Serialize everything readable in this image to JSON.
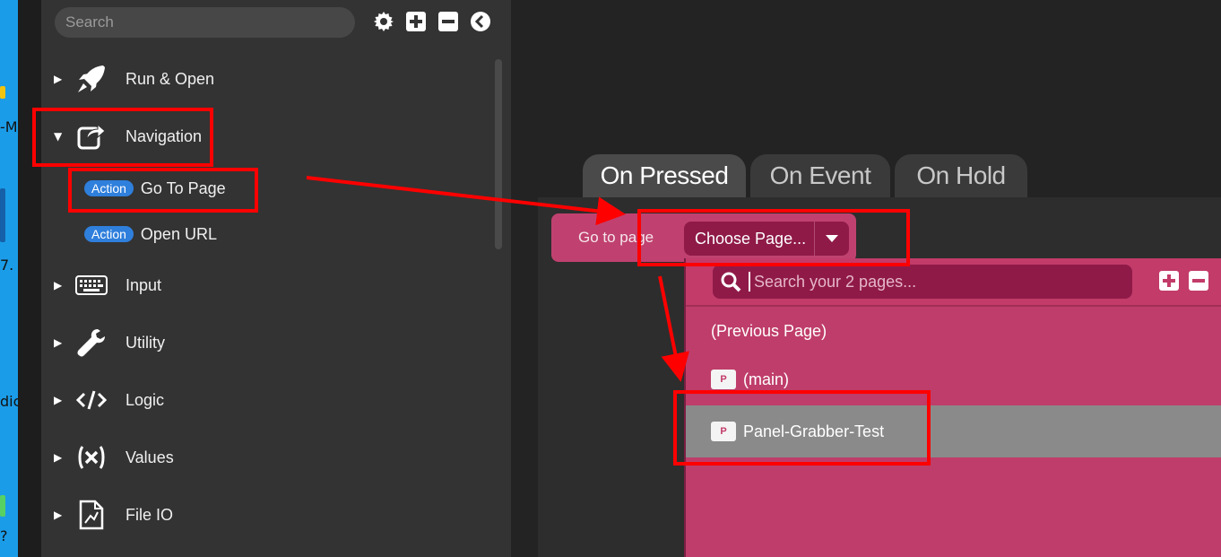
{
  "desktop": {
    "fragments": [
      "-M",
      "7.",
      "dic",
      "?"
    ]
  },
  "sidebar": {
    "search_placeholder": "Search",
    "toolbar_icons": [
      "gear-icon",
      "expand-all-icon",
      "collapse-all-icon",
      "back-icon"
    ],
    "categories": [
      {
        "label": "Run & Open",
        "icon": "rocket-icon",
        "expanded": false
      },
      {
        "label": "Navigation",
        "icon": "share-icon",
        "expanded": true
      },
      {
        "label": "Input",
        "icon": "keyboard-icon",
        "expanded": false
      },
      {
        "label": "Utility",
        "icon": "wrench-icon",
        "expanded": false
      },
      {
        "label": "Logic",
        "icon": "code-icon",
        "expanded": false
      },
      {
        "label": "Values",
        "icon": "variable-icon",
        "expanded": false
      },
      {
        "label": "File IO",
        "icon": "file-icon",
        "expanded": false
      }
    ],
    "navigation_actions": [
      {
        "badge": "Action",
        "label": "Go To Page"
      },
      {
        "badge": "Action",
        "label": "Open URL"
      }
    ]
  },
  "tabs": [
    {
      "label": "On Pressed",
      "active": true
    },
    {
      "label": "On Event",
      "active": false
    },
    {
      "label": "On Hold",
      "active": false
    }
  ],
  "action_block": {
    "label": "Go to page",
    "dropdown_value": "Choose Page..."
  },
  "page_picker": {
    "search_placeholder": "Search your 2 pages...",
    "items": [
      {
        "label": "(Previous Page)",
        "icon": null,
        "selected": false
      },
      {
        "label": "(main)",
        "icon": "page-icon",
        "selected": false
      },
      {
        "label": "Panel-Grabber-Test",
        "icon": "page-icon",
        "selected": true
      }
    ]
  },
  "colors": {
    "accent_blue": "#2f7fdc",
    "action_pink": "#c0416f",
    "dropdown_pink": "#c23b69",
    "annotation_red": "#ff0000",
    "sidebar_bg": "#333333"
  }
}
